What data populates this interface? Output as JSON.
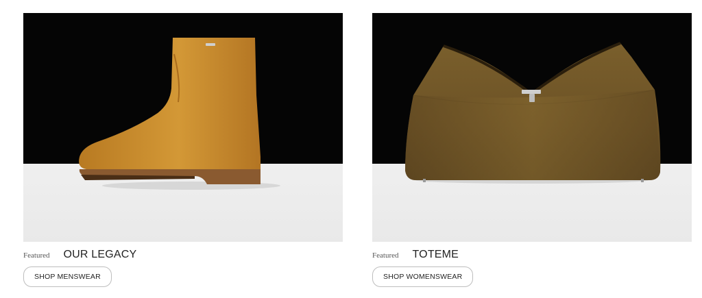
{
  "cards": [
    {
      "featured_label": "Featured",
      "brand": "OUR LEGACY",
      "button_label": "SHOP MENSWEAR",
      "image": {
        "subject": "tan-leather-ankle-boot",
        "colors": {
          "backdrop": "#050505",
          "floor": "#ececec",
          "leather": "#c98a2b",
          "sole": "#8a5a30"
        }
      }
    },
    {
      "featured_label": "Featured",
      "brand": "TOTEME",
      "button_label": "SHOP WOMENSWEAR",
      "image": {
        "subject": "olive-leather-handbag",
        "colors": {
          "backdrop": "#050505",
          "floor": "#ececec",
          "leather": "#6e5527",
          "hardware": "#c9c9c9"
        }
      }
    }
  ]
}
